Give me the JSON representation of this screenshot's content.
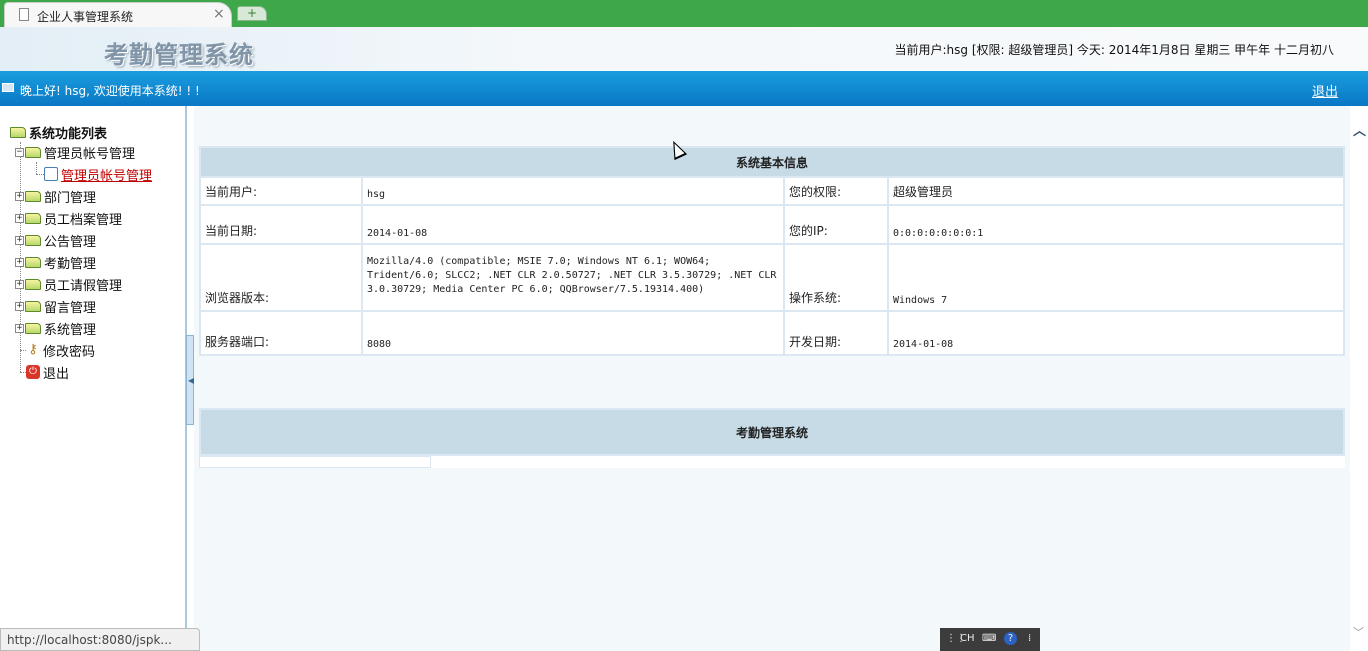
{
  "browser": {
    "tab_title": "企业人事管理系统",
    "tab_close": "×",
    "new_tab": "+",
    "status_url": "http://localhost:8080/jspk..."
  },
  "header": {
    "logo_text": "考勤管理系统",
    "user_info": "当前用户:hsg [权限: 超级管理员] 今天: 2014年1月8日 星期三 甲午年 十二月初八"
  },
  "welcome_bar": {
    "message": "晚上好! hsg, 欢迎使用本系统! ! !",
    "logout_label": "退出"
  },
  "sidebar": {
    "root_label": "系统功能列表",
    "items": [
      {
        "label": "管理员帐号管理",
        "expanded": true
      },
      {
        "label": "管理员帐号管理",
        "child": true
      },
      {
        "label": "部门管理"
      },
      {
        "label": "员工档案管理"
      },
      {
        "label": "公告管理"
      },
      {
        "label": "考勤管理"
      },
      {
        "label": "员工请假管理"
      },
      {
        "label": "留言管理"
      },
      {
        "label": "系统管理"
      },
      {
        "label": "修改密码",
        "icon": "key-icon"
      },
      {
        "label": "退出",
        "icon": "exit-icon"
      }
    ]
  },
  "info_table": {
    "title": "系统基本信息",
    "rows": [
      {
        "l1": "当前用户:",
        "v1": "hsg",
        "l2": "您的权限:",
        "v2": "超级管理员"
      },
      {
        "l1": "当前日期:",
        "v1": "2014-01-08",
        "l2": "您的IP:",
        "v2": "0:0:0:0:0:0:0:1"
      },
      {
        "l1": "浏览器版本:",
        "v1": "Mozilla/4.0 (compatible; MSIE 7.0; Windows NT 6.1; WOW64; Trident/6.0; SLCC2; .NET CLR 2.0.50727; .NET CLR 3.5.30729; .NET CLR 3.0.30729; Media Center PC 6.0; QQBrowser/7.5.19314.400)",
        "l2": "操作系统:",
        "v2": "Windows 7"
      },
      {
        "l1": "服务器端口:",
        "v1": "8080",
        "l2": "开发日期:",
        "v2": "2014-01-08"
      }
    ]
  },
  "panel2": {
    "title": "考勤管理系统"
  },
  "ime": {
    "lang": "CH",
    "help": "?"
  }
}
